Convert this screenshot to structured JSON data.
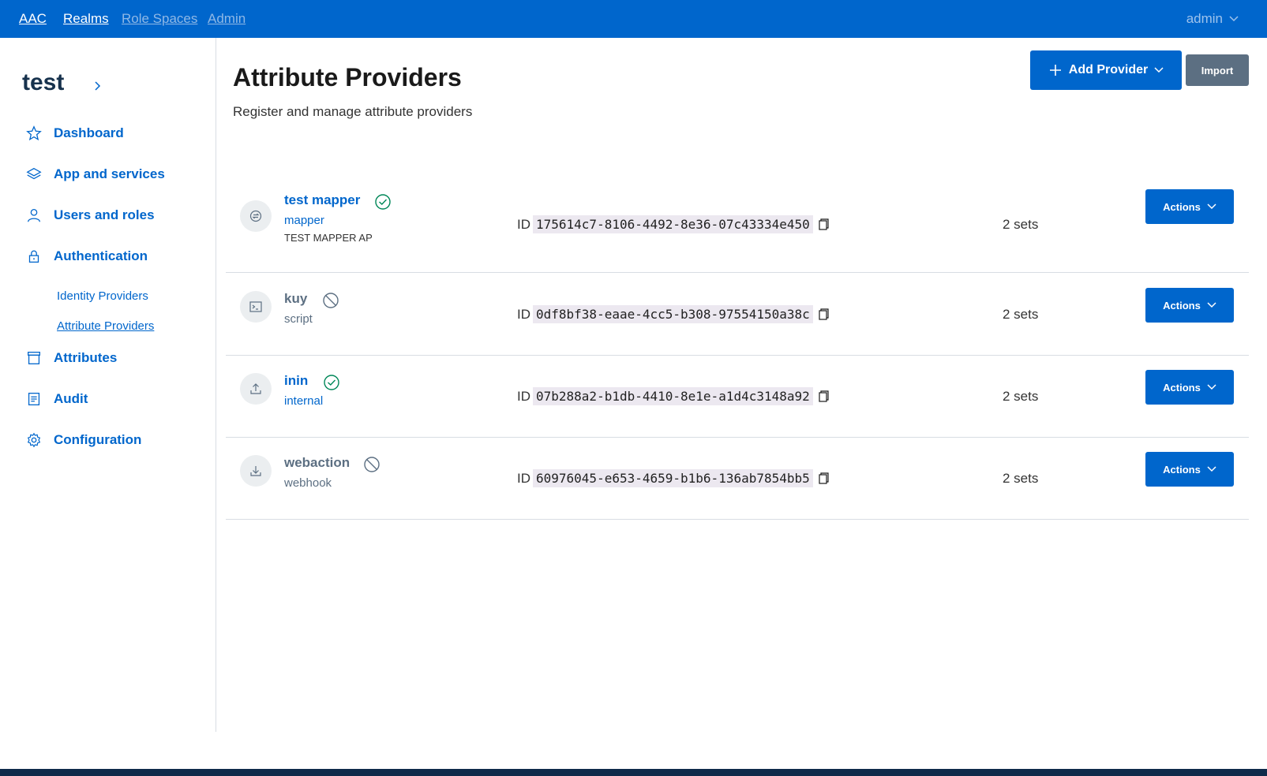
{
  "topnav": {
    "brand": "AAC",
    "links": [
      "Realms",
      "Role Spaces",
      "Admin"
    ],
    "user": "admin"
  },
  "sidebar": {
    "realm": "test",
    "items": [
      {
        "label": "Dashboard",
        "icon": "star-icon"
      },
      {
        "label": "App and services",
        "icon": "layers-icon"
      },
      {
        "label": "Users and roles",
        "icon": "user-icon"
      },
      {
        "label": "Authentication",
        "icon": "lock-icon"
      },
      {
        "label": "Attributes",
        "icon": "archive-icon"
      },
      {
        "label": "Audit",
        "icon": "file-text-icon"
      },
      {
        "label": "Configuration",
        "icon": "gear-icon"
      }
    ],
    "subitems": [
      {
        "label": "Identity Providers",
        "active": false
      },
      {
        "label": "Attribute Providers",
        "active": true
      }
    ]
  },
  "main": {
    "title": "Attribute Providers",
    "subtitle": "Register and manage attribute providers",
    "add_button": "Add Provider",
    "import_button": "Import"
  },
  "providers": [
    {
      "name": "test mapper",
      "type": "mapper",
      "description": "TEST MAPPER AP",
      "enabled": true,
      "id_label": "ID",
      "id": "175614c7-8106-4492-8e36-07c43334e450",
      "sets": "2 sets",
      "actions": "Actions",
      "icon": "mapper-icon"
    },
    {
      "name": "kuy",
      "type": "script",
      "description": "",
      "enabled": false,
      "id_label": "ID",
      "id": "0df8bf38-eaae-4cc5-b308-97554150a38c",
      "sets": "2 sets",
      "actions": "Actions",
      "icon": "terminal-icon"
    },
    {
      "name": "inin",
      "type": "internal",
      "description": "",
      "enabled": true,
      "id_label": "ID",
      "id": "07b288a2-b1db-4410-8e1e-a1d4c3148a92",
      "sets": "2 sets",
      "actions": "Actions",
      "icon": "upload-icon"
    },
    {
      "name": "webaction",
      "type": "webhook",
      "description": "",
      "enabled": false,
      "id_label": "ID",
      "id": "60976045-e653-4659-b1b6-136ab7854bb5",
      "sets": "2 sets",
      "actions": "Actions",
      "icon": "download-icon"
    }
  ],
  "colors": {
    "primary": "#0066cc",
    "enabled": "#008758",
    "disabled": "#5c6f82"
  }
}
